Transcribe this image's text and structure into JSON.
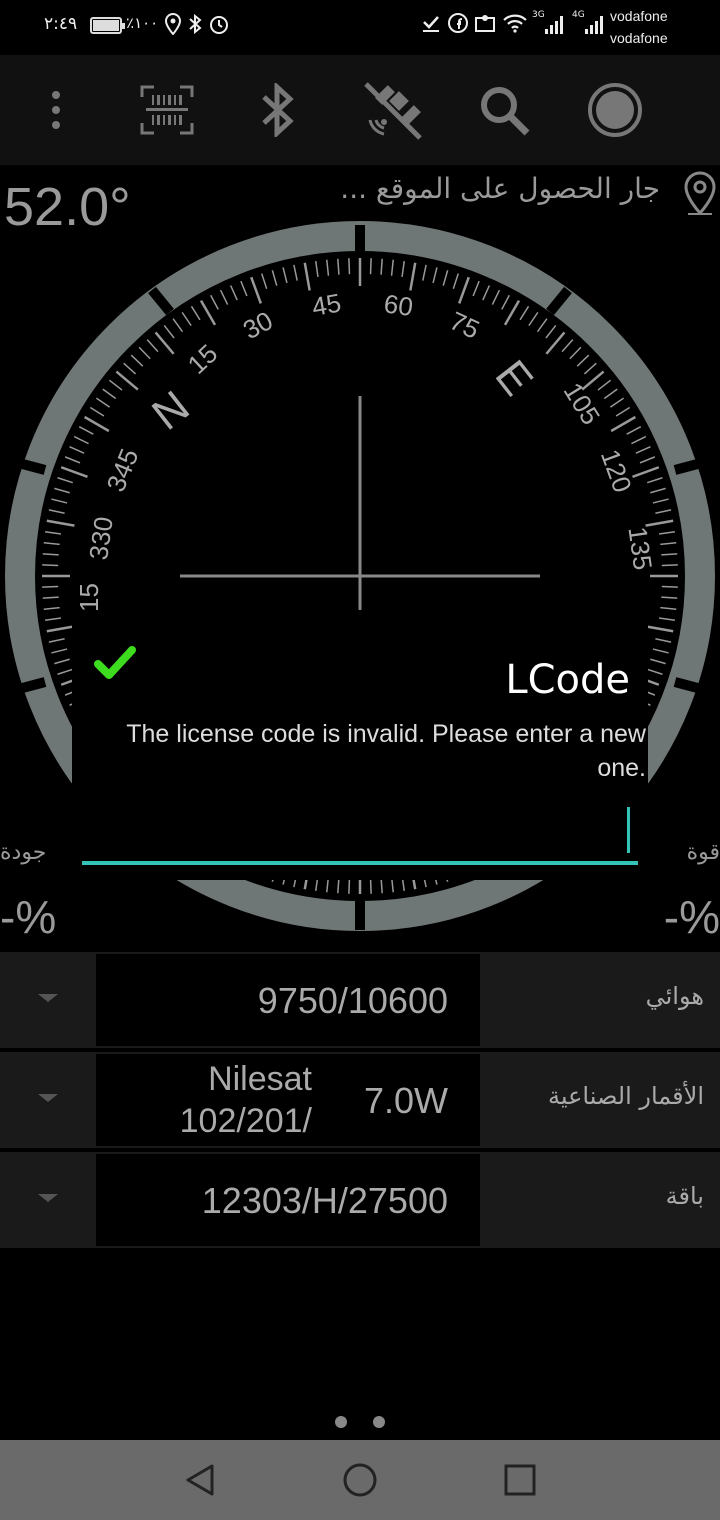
{
  "status": {
    "time": "٢:٤٩",
    "battery_percent_text": "٪١٠٠",
    "network_3g": "3G",
    "network_4g": "4G",
    "carrier1": "vodafone",
    "carrier2": "vodafone"
  },
  "toolbar": {
    "icons": [
      "more-vert-icon",
      "barcode-scan-icon",
      "bluetooth-icon",
      "satellite-off-icon",
      "search-icon",
      "record-icon"
    ]
  },
  "header": {
    "azimuth": "52.0°",
    "location_status": "جار الحصول على الموقع ..."
  },
  "compass": {
    "cardinals": [
      "N",
      "E"
    ],
    "ticks": [
      "15",
      "30",
      "45",
      "60",
      "75",
      "105",
      "120",
      "135",
      "345",
      "330",
      "15"
    ]
  },
  "signal": {
    "quality_label": "جودة",
    "quality_value": "-%",
    "strength_label": "قوة",
    "strength_value": "-%"
  },
  "dialog": {
    "title": "LCode",
    "message": "The license code is invalid. Please enter a new one.",
    "input_value": "",
    "accent_color": "#34c3b8",
    "check_color": "#3ddc1e"
  },
  "rows": {
    "lnb": {
      "label": "هوائي",
      "value": "9750/10600"
    },
    "satellite": {
      "label": "الأقمار الصناعية",
      "position": "7.0W",
      "name": "Nilesat 102/201/"
    },
    "transponder": {
      "label": "باقة",
      "value": "12303/H/27500"
    }
  },
  "navbar": {
    "icons": [
      "back-icon",
      "home-icon",
      "recents-icon"
    ]
  }
}
